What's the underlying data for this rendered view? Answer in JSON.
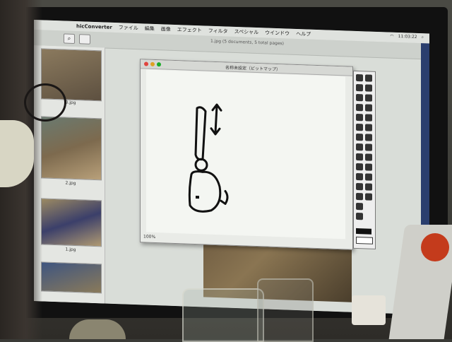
{
  "menubar": {
    "app_name": "hicConverter",
    "items": [
      "ファイル",
      "編集",
      "画像",
      "エフェクト",
      "フィルタ",
      "スペシャル",
      "ウインドウ",
      "ヘルプ"
    ],
    "clock": "11:03:22"
  },
  "browser": {
    "doc_title": "1.jpg (5 documents, 5 total pages)"
  },
  "thumbnails": [
    {
      "label": "3.jpg"
    },
    {
      "label": "2.jpg"
    },
    {
      "label": "1.jpg"
    }
  ],
  "drawing_window": {
    "title": "名称未設定（ビットマップ）",
    "zoom": "100%"
  }
}
